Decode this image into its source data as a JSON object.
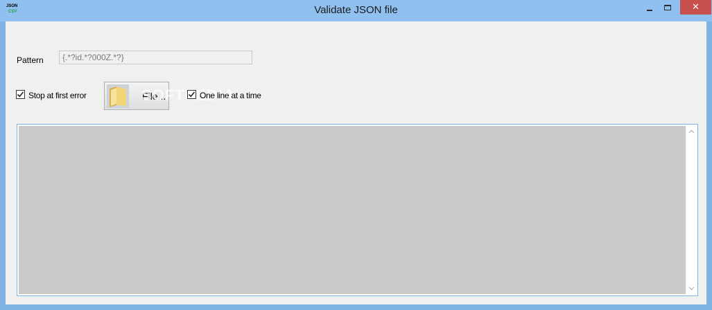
{
  "window": {
    "title": "Validate JSON file",
    "icon_lines": [
      "JSON",
      "CSV"
    ],
    "close_glyph": "✕"
  },
  "form": {
    "pattern_label": "Pattern",
    "pattern_value": "{.*?id.*?000Z.*?}",
    "stop_at_first_error": {
      "label": "Stop at first error",
      "checked": true
    },
    "one_line_at_a_time": {
      "label": "One line at a time",
      "checked": true
    },
    "file_button_label": "File...",
    "watermark": "SOFTPEDIA"
  },
  "output": {
    "text": ""
  },
  "icons": {
    "app": "json-csv-app-icon",
    "folder": "folder-icon",
    "minimize": "minimize-icon",
    "maximize": "maximize-icon",
    "close": "close-icon",
    "check": "checkmark-icon",
    "scroll_up": "chevron-up-icon",
    "scroll_down": "chevron-down-icon"
  },
  "colors": {
    "titlebar": "#8fc0ef",
    "close_button": "#c7504c",
    "client_bg": "#f0f0f0",
    "output_bg": "#c9c9c9",
    "output_border": "#7ab4e6"
  }
}
